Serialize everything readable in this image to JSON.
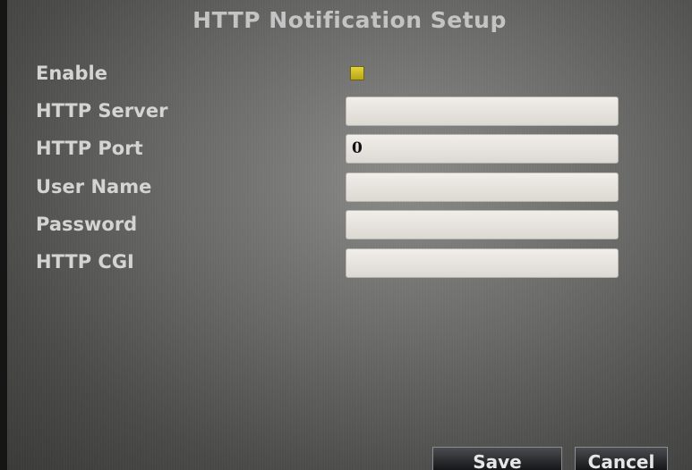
{
  "title": "HTTP Notification Setup",
  "form": {
    "enable": {
      "label": "Enable",
      "checked": true,
      "color": "#d4c42a"
    },
    "server": {
      "label": "HTTP Server",
      "value": ""
    },
    "port": {
      "label": "HTTP Port",
      "value": "0"
    },
    "username": {
      "label": "User Name",
      "value": ""
    },
    "password": {
      "label": "Password",
      "value": ""
    },
    "cgi": {
      "label": "HTTP CGI",
      "value": ""
    }
  },
  "buttons": {
    "save": "Save",
    "cancel": "Cancel"
  }
}
